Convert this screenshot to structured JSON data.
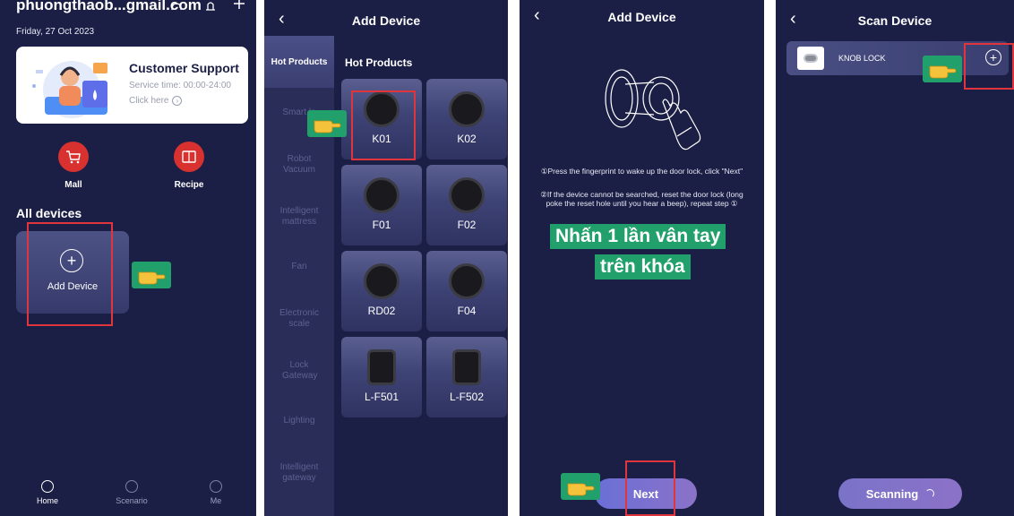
{
  "panel1": {
    "account": "phuongthaob...gmail.com",
    "date": "Friday, 27 Oct 2023",
    "support": {
      "title": "Customer Support",
      "service_time": "Service time: 00:00-24:00",
      "click_here": "Click here"
    },
    "shortcuts": [
      {
        "label": "Mall",
        "icon": "cart-icon"
      },
      {
        "label": "Recipe",
        "icon": "book-icon"
      }
    ],
    "all_devices": "All devices",
    "add_device": "Add Device",
    "nav": [
      {
        "label": "Home"
      },
      {
        "label": "Scenario"
      },
      {
        "label": "Me"
      }
    ]
  },
  "panel2": {
    "title": "Add Device",
    "back": "‹",
    "categories": [
      "Hot Products",
      "Smart lo",
      "Robot Vacuum",
      "Intelligent mattress",
      "Fan",
      "Electronic scale",
      "Lock Gateway",
      "Lighting",
      "Intelligent gateway"
    ],
    "section": "Hot Products",
    "products": [
      "K01",
      "K02",
      "F01",
      "F02",
      "RD02",
      "F04",
      "L-F501",
      "L-F502"
    ]
  },
  "panel3": {
    "title": "Add Device",
    "back": "‹",
    "instruction1": "①Press the fingerprint to wake up the door lock, click \"Next\"",
    "instruction2": "②If the device cannot be searched, reset the door lock (long poke the reset hole until you hear a beep), repeat step ①",
    "overlay_line1": "Nhấn 1 lần vân tay",
    "overlay_line2": "trên khóa",
    "next": "Next"
  },
  "panel4": {
    "title": "Scan Device",
    "back": "‹",
    "device_name": "KNOB LOCK",
    "add_symbol": "+",
    "scanning": "Scanning"
  },
  "colors": {
    "background": "#1c1f45",
    "highlight": "#e0353d",
    "overlay_green": "#22a06b",
    "accent_red": "#d8312f"
  }
}
